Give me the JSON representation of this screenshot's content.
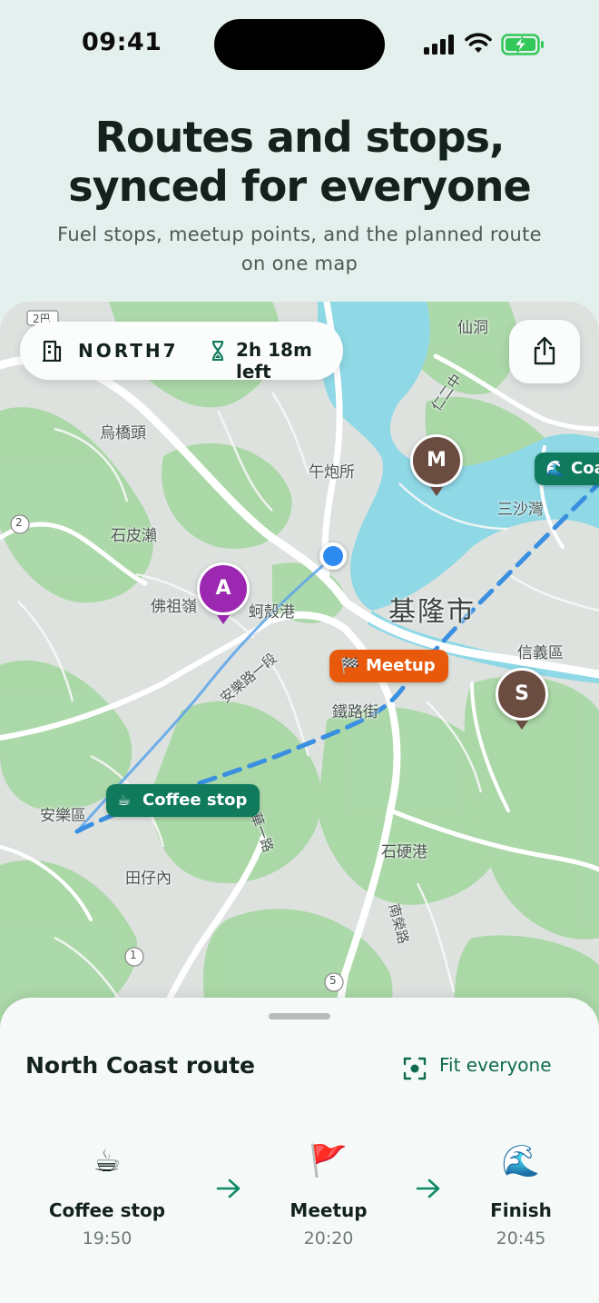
{
  "status": {
    "time": "09:41"
  },
  "hero": {
    "title_line1": "Routes and stops,",
    "title_line2": "synced for everyone",
    "subtitle_line1": "Fuel stops, meetup points, and the planned route",
    "subtitle_line2": "on one map"
  },
  "map": {
    "group_code": "NORTH7",
    "time_left": "2h 18m left",
    "places": [
      "仙洞",
      "烏橋頭",
      "午炮所",
      "三沙灣",
      "石皮瀨",
      "佛祖嶺",
      "蚵殼港",
      "基隆市",
      "信義區",
      "鐵路街",
      "安樂區",
      "田仔內",
      "石硬港",
      "南榮路",
      "仁二中",
      "安樂路一段",
      "大華一路",
      "2",
      "1",
      "5",
      "2巴"
    ],
    "pins": [
      {
        "letter": "M",
        "color": "#6b4c40"
      },
      {
        "letter": "A",
        "color": "#9c27b0"
      },
      {
        "letter": "S",
        "color": "#6b4c40"
      }
    ],
    "tags": {
      "coast": {
        "icon": "🌊",
        "label": "Coa"
      },
      "meetup": {
        "icon": "🏁",
        "label": "Meetup"
      },
      "coffee": {
        "icon": "☕",
        "label": "Coffee stop"
      }
    },
    "colors": {
      "water": "#8fd8e6",
      "park": "#a8d8a8",
      "route": "#3a8fe0",
      "land": "#dde2df"
    }
  },
  "sheet": {
    "title": "North Coast route",
    "fit_label": "Fit everyone",
    "stops": [
      {
        "icon": "☕",
        "name": "Coffee stop",
        "time": "19:50"
      },
      {
        "icon": "🚩",
        "name": "Meetup",
        "time": "20:20"
      },
      {
        "icon": "🌊",
        "name": "Finish",
        "time": "20:45"
      }
    ]
  }
}
